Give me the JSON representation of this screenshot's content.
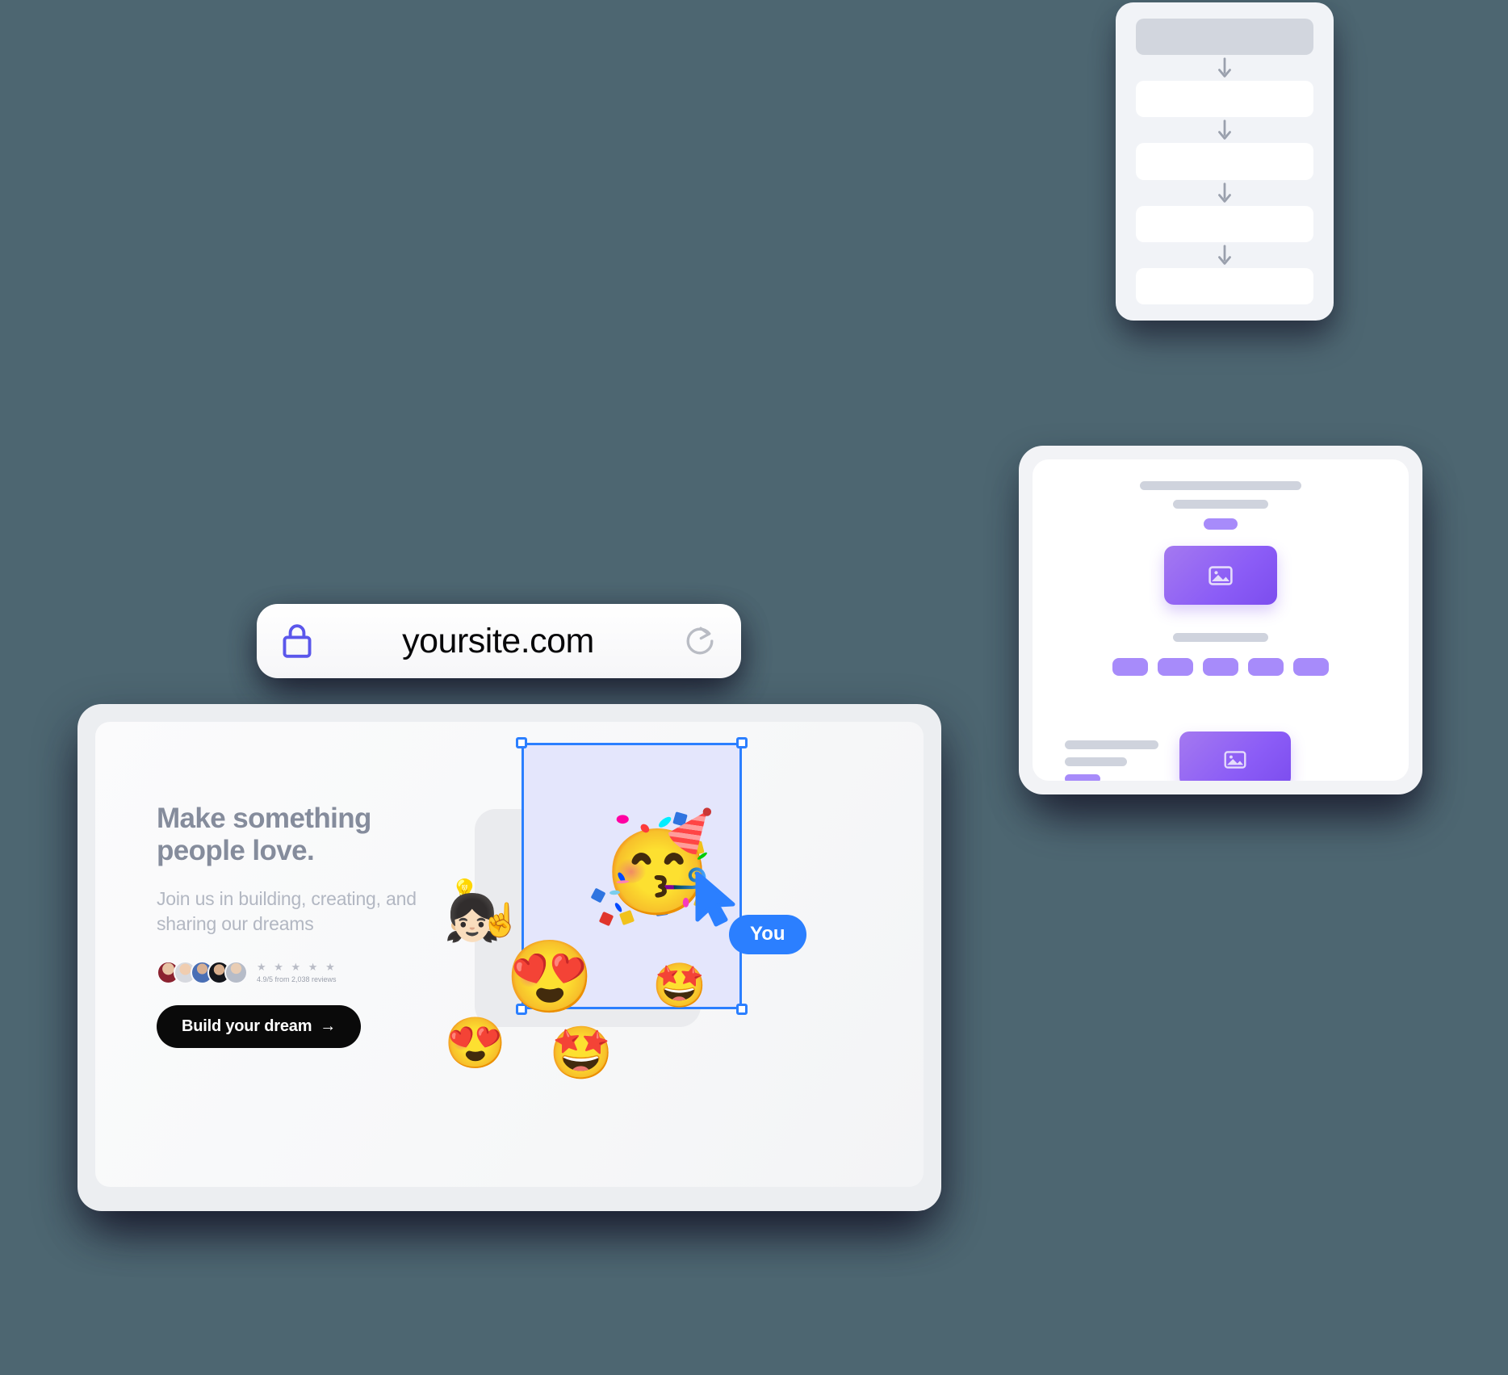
{
  "background_color": "#4d6671",
  "browser": {
    "url_bar": {
      "lock_icon": "lock-icon",
      "url": "yoursite.com",
      "reload_icon": "reload-icon",
      "accent_color": "#5b57eb"
    },
    "page": {
      "hero": {
        "heading_line1": "Make something",
        "heading_line2": "people love.",
        "subheading": "Join us in building, creating, and sharing our dreams",
        "heading_color": "#858c9c",
        "subheading_color": "#b2b7c2"
      },
      "reviews": {
        "stars": "★ ★ ★ ★ ★",
        "star_count": 5,
        "rating_text": "4.9/5 from 2,038 reviews",
        "rating_value": "4.9/5",
        "review_count": "2,038",
        "avatar_count": 5
      },
      "cta": {
        "label": "Build your dream",
        "arrow": "→",
        "background": "#0a0a0a",
        "text_color": "#ffffff"
      },
      "canvas": {
        "selection": {
          "border_color": "#2b7fff",
          "fill_color": "#e4e6fc",
          "handles": [
            "top-left",
            "top-right",
            "bottom-left",
            "bottom-right"
          ]
        },
        "cursor": {
          "label": "You",
          "color": "#2b7fff"
        },
        "stickers": [
          {
            "name": "partying-face-memoji",
            "glyph": "🥳"
          },
          {
            "name": "idea-memoji",
            "glyph": "💡"
          },
          {
            "name": "pointing-up-memoji",
            "glyph": "☝️"
          },
          {
            "name": "heart-eyes-curly-memoji",
            "glyph": "😍"
          },
          {
            "name": "star-struck-memoji",
            "glyph": "🤩"
          },
          {
            "name": "heart-eyes-memoji",
            "glyph": "😍"
          },
          {
            "name": "star-struck-dark-memoji",
            "glyph": "🤩"
          }
        ]
      }
    }
  },
  "flow_card": {
    "name": "flow-diagram-card",
    "background": "#f1f3f7",
    "head_block_color": "#d2d6de",
    "block_color": "#ffffff",
    "arrow_color": "#9aa0ad",
    "blocks": 5,
    "arrows": 4
  },
  "tablet_card": {
    "name": "tablet-wireframe-card",
    "frame_color": "#f2f3f6",
    "screen_color": "#ffffff",
    "bar_color": "#cfd3dd",
    "pill_color": "#a78bfa",
    "image_gradient_from": "#a479f0",
    "image_gradient_to": "#7c4dee",
    "sections": [
      {
        "name": "hero-section",
        "bars": 2,
        "pill": 1,
        "image_placeholders": 1
      },
      {
        "name": "features-section",
        "bars": 1,
        "pills": 5
      },
      {
        "name": "content-section",
        "bars": 2,
        "pill": 1,
        "image_placeholders": 1
      }
    ],
    "image_icon": "image-placeholder-icon"
  }
}
